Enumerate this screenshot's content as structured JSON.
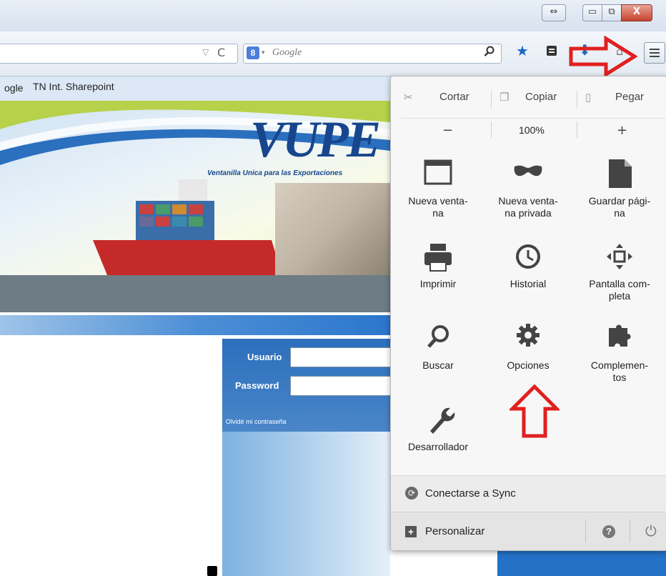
{
  "window": {
    "controls": {
      "resize": "⇔",
      "minimize": "▭",
      "maximize": "⧉",
      "close": "X"
    }
  },
  "navbar": {
    "url_dropdown": "▽",
    "reload": "C",
    "search": {
      "engine_icon": "8",
      "engine_arrow": "▾",
      "placeholder": "Google",
      "go": "⚲"
    },
    "icons": {
      "bookmark": "★",
      "bookmarks_list": "☰",
      "downloads": "⬇",
      "home": "⌂"
    }
  },
  "bookmarks_bar": {
    "items": [
      "ogle",
      "TN Int. Sharepoint"
    ]
  },
  "page": {
    "logo": "VUPE",
    "tagline": "Ventanilla Unica para las Exportaciones",
    "login": {
      "user_label": "Usuario",
      "password_label": "Password",
      "forgot": "Olvidé mi contraseña"
    }
  },
  "menu": {
    "edit": {
      "cut": "Cortar",
      "copy": "Copiar",
      "paste": "Pegar"
    },
    "zoom": {
      "minus": "−",
      "level": "100%",
      "plus": "+"
    },
    "items": [
      {
        "label": "Nueva venta-\nna",
        "icon": "new-window-icon"
      },
      {
        "label": "Nueva venta-\nna privada",
        "icon": "private-window-icon"
      },
      {
        "label": "Guardar pági-\nna",
        "icon": "save-page-icon"
      },
      {
        "label": "Imprimir",
        "icon": "print-icon"
      },
      {
        "label": "Historial",
        "icon": "history-icon"
      },
      {
        "label": "Pantalla com-\npleta",
        "icon": "fullscreen-icon"
      },
      {
        "label": "Buscar",
        "icon": "search-icon"
      },
      {
        "label": "Opciones",
        "icon": "options-gear-icon"
      },
      {
        "label": "Complemen-\ntos",
        "icon": "addons-icon"
      },
      {
        "label": "Desarrollador",
        "icon": "developer-wrench-icon"
      }
    ],
    "sync": "Conectarse a Sync",
    "customize": "Personalizar",
    "help": "?",
    "quit": "⏻"
  },
  "colors": {
    "annotation_arrow": "#e02020",
    "accent_blue": "#1b69c5"
  }
}
